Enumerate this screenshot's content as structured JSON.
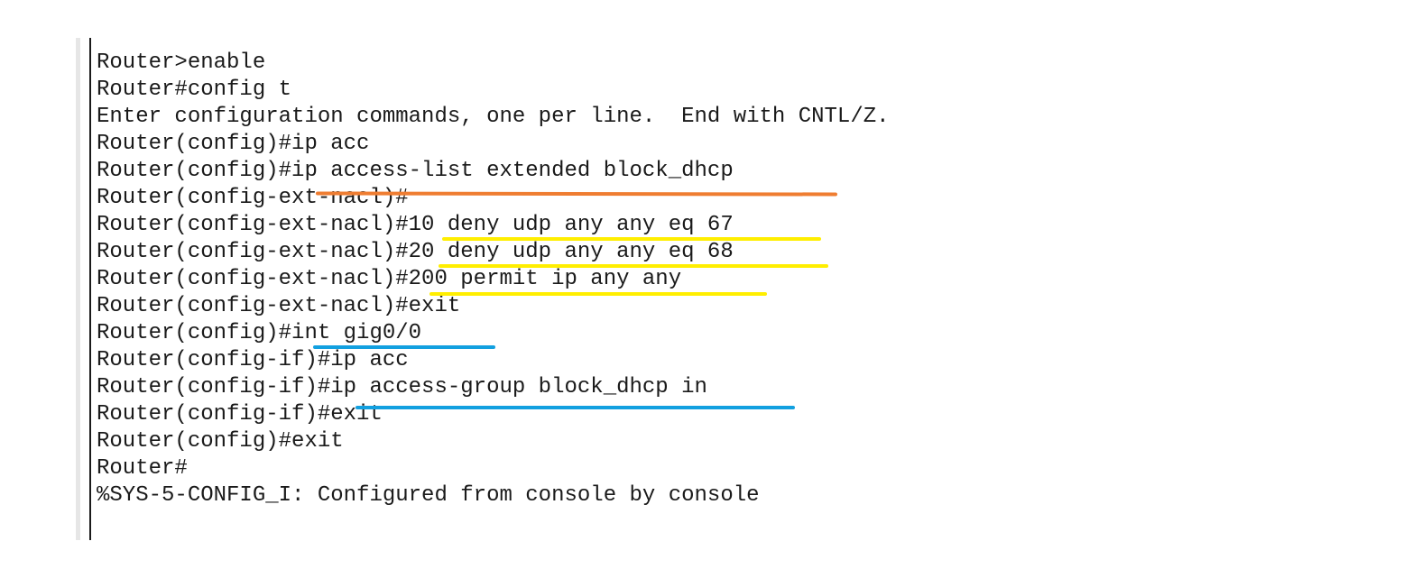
{
  "terminal": {
    "lines": [
      "Router>enable",
      "Router#config t",
      "Enter configuration commands, one per line.  End with CNTL/Z.",
      "Router(config)#ip acc",
      "Router(config)#ip access-list extended block_dhcp",
      "Router(config-ext-nacl)#",
      "Router(config-ext-nacl)#10 deny udp any any eq 67",
      "Router(config-ext-nacl)#20 deny udp any any eq 68",
      "Router(config-ext-nacl)#200 permit ip any any",
      "Router(config-ext-nacl)#exit",
      "Router(config)#int gig0/0",
      "Router(config-if)#ip acc",
      "Router(config-if)#ip access-group block_dhcp in",
      "Router(config-if)#exit",
      "Router(config)#exit",
      "Router#",
      "%SYS-5-CONFIG_I: Configured from console by console"
    ]
  },
  "highlight_colors": {
    "orange": "#ef7d31",
    "yellow": "#ffee00",
    "blue": "#12a0e0"
  }
}
